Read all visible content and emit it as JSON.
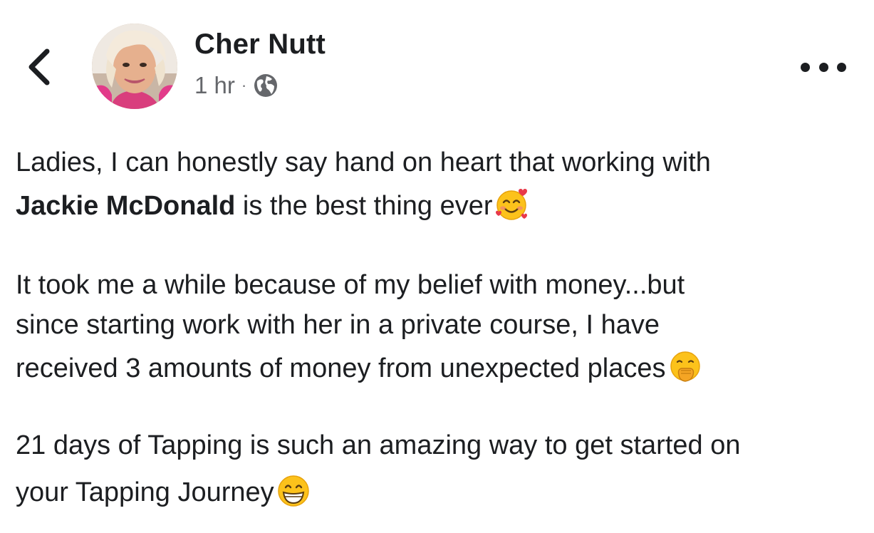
{
  "header": {
    "back_icon": "chevron-left-icon",
    "author_name": "Cher Nutt",
    "timestamp": "1 hr",
    "separator": "·",
    "privacy_icon": "globe-icon",
    "more_icon": "more-horizontal-icon"
  },
  "post": {
    "paragraph1": {
      "line1": "Ladies, I can honestly say hand on heart that working with",
      "mention": "Jackie McDonald",
      "line2_rest": " is the best thing ever",
      "emoji": "smiling-face-with-hearts-emoji"
    },
    "paragraph2": {
      "line1": "It took me a while because of my belief with money...but",
      "line2": "since starting work with her in a private course, I have",
      "line3": "received 3 amounts of money from unexpected places",
      "emoji": "face-with-hand-over-mouth-emoji"
    },
    "paragraph3": {
      "line1": "21 days of Tapping is such an amazing way to get started on",
      "line2": "your Tapping Journey",
      "emoji": "grinning-face-emoji"
    }
  },
  "colors": {
    "text_primary": "#1c1e21",
    "text_secondary": "#65676b",
    "background": "#ffffff",
    "emoji_yellow": "#fcc21b",
    "heart_red": "#e8394a"
  }
}
